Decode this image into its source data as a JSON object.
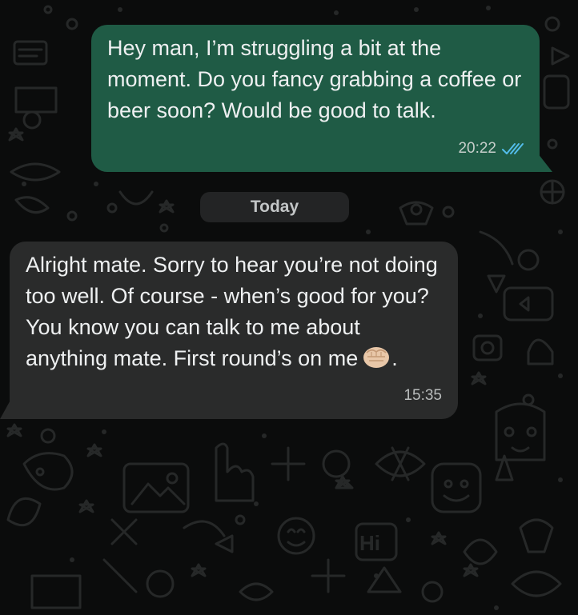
{
  "chat": {
    "messages": [
      {
        "direction": "outgoing",
        "text": "Hey man, I’m struggling a bit at the moment. Do you fancy grabbing a coffee or beer soon? Would be good to talk.",
        "time": "20:22",
        "status": "read",
        "status_icon": "double-check-icon"
      },
      {
        "direction": "incoming",
        "text": "Alright mate. Sorry to hear you’re not doing too well. Of course - when’s good for you? You know you can talk to me about anything mate. First round’s on me",
        "emoji": "fist-emoji",
        "trailing_text": ".",
        "time": "15:35"
      }
    ],
    "date_separator": "Today"
  },
  "colors": {
    "background": "#0b0c0c",
    "outgoing_bubble": "#1f5b45",
    "incoming_bubble": "#2a2b2b",
    "read_ticks": "#53bdeb",
    "text": "#eef0f1"
  }
}
